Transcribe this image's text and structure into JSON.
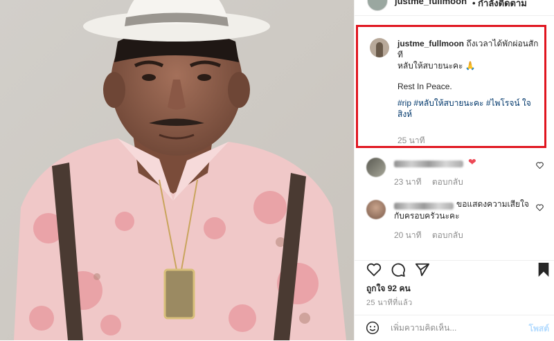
{
  "post_image": {
    "alt": ""
  },
  "header": {
    "username": "justme_fullmoon",
    "follow_label": "• กำลังติดตาม"
  },
  "caption": {
    "username": "justme_fullmoon",
    "line1": "ถึงเวลาได้พักผ่อนสักที",
    "line2": "หลับให้สบายนะคะ 🙏",
    "line3": "Rest In Peace.",
    "hashtags": "#rip #หลับให้สบายนะคะ #ไพโรจน์ ใจสิงห์",
    "time": "25 นาที"
  },
  "comments": [
    {
      "text": "",
      "emoji": "❤",
      "time": "23 นาที",
      "reply": "ตอบกลับ"
    },
    {
      "text": "ขอแสดงความเสียใจกับครอบครัวนะคะ",
      "time": "20 นาที",
      "reply": "ตอบกลับ"
    }
  ],
  "likes": "ถูกใจ 92 คน",
  "posted_time": "25 นาทีที่แล้ว",
  "add_comment": {
    "placeholder": "เพิ่มความคิดเห็น...",
    "post_label": "โพสต์"
  },
  "icons": [
    "heart-icon",
    "comment-icon",
    "share-icon",
    "bookmark-icon",
    "emoji-icon",
    "small-heart-icon"
  ]
}
